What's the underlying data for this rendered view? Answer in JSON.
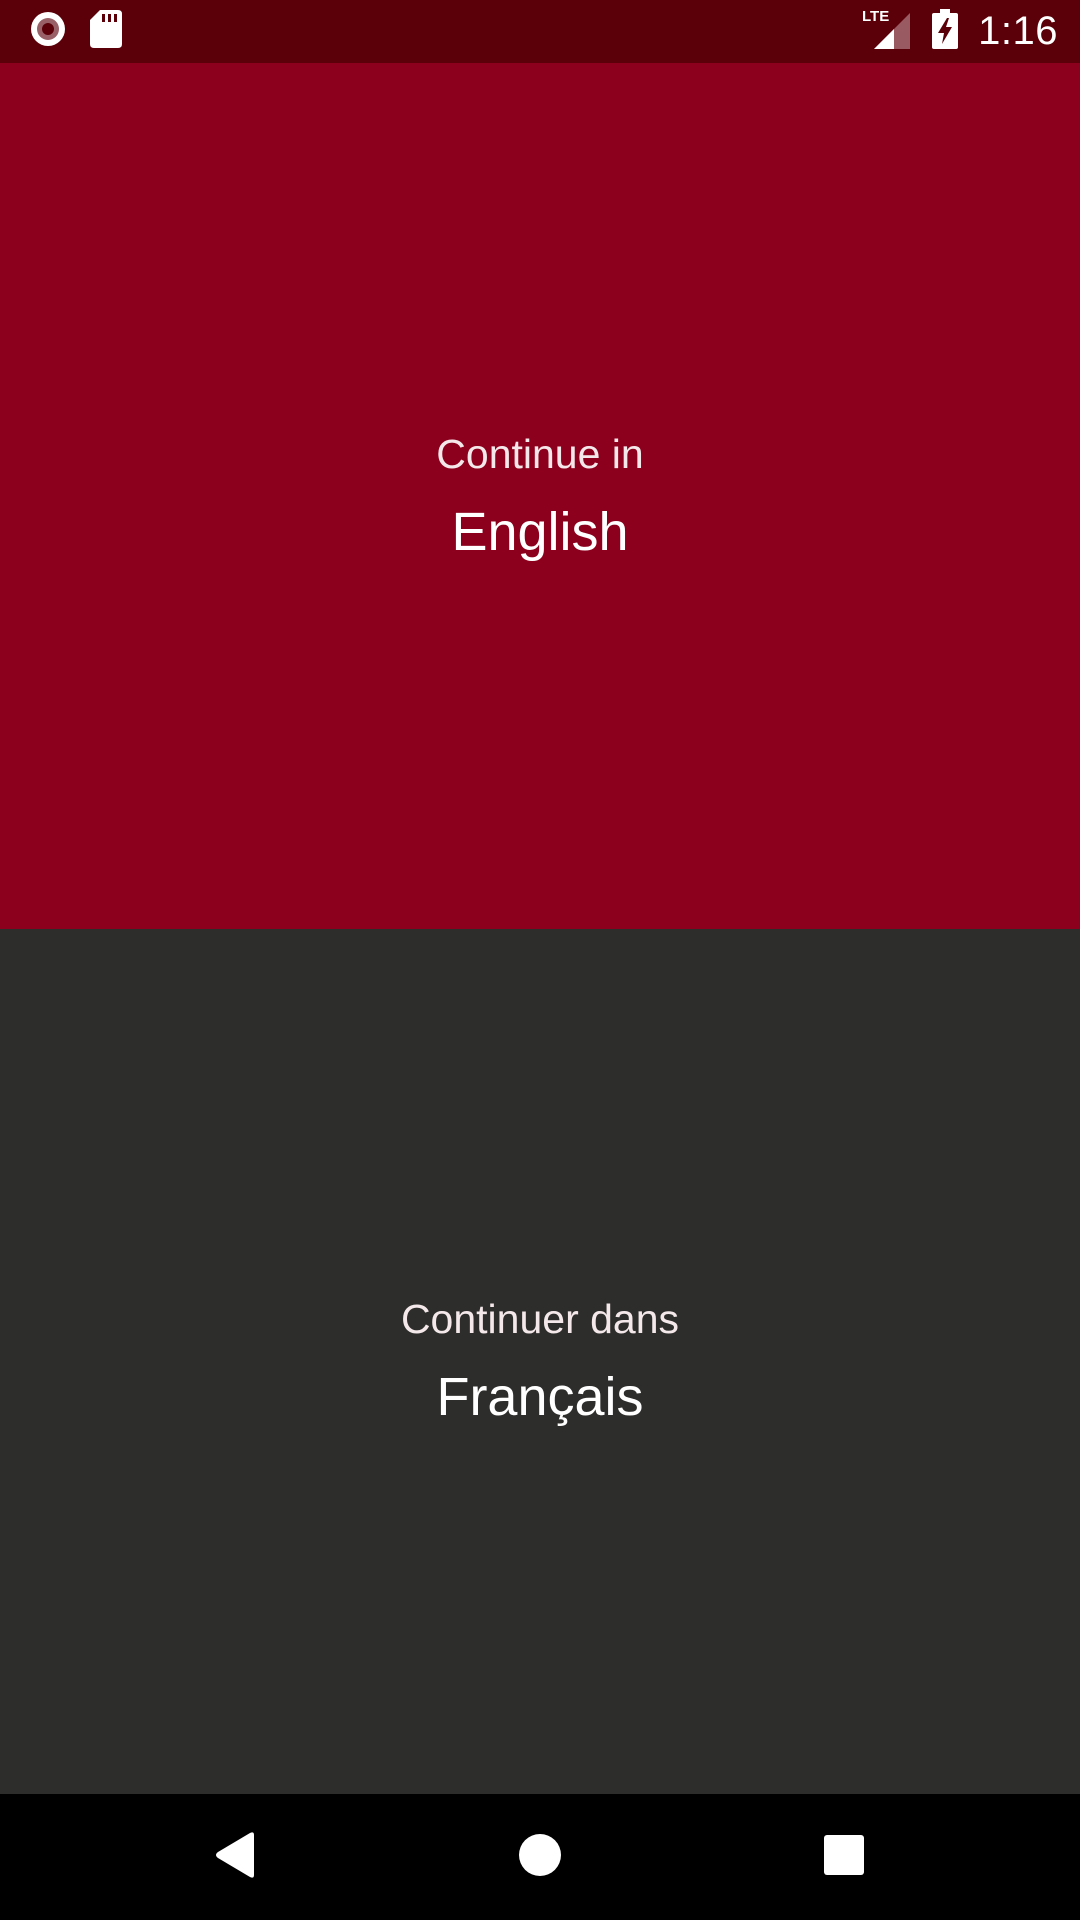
{
  "status_bar": {
    "left_icons": [
      "record-icon",
      "sd-card-icon"
    ],
    "network_label": "LTE",
    "right_icons": [
      "lte-signal-icon",
      "battery-charging-icon"
    ],
    "time": "1:16"
  },
  "options": {
    "english": {
      "prompt": "Continue in",
      "language": "English",
      "background_color": "#8d001d"
    },
    "french": {
      "prompt": "Continuer dans",
      "language": "Français",
      "background_color": "#2d2d2c"
    }
  },
  "navigation": {
    "icons": [
      "back-icon",
      "home-icon",
      "recents-icon"
    ]
  },
  "colors": {
    "status_bar": "#5b0008",
    "accent": "#8d001d",
    "dark_panel": "#2d2d2c",
    "nav_bar": "#000000",
    "text": "#ffffff"
  }
}
